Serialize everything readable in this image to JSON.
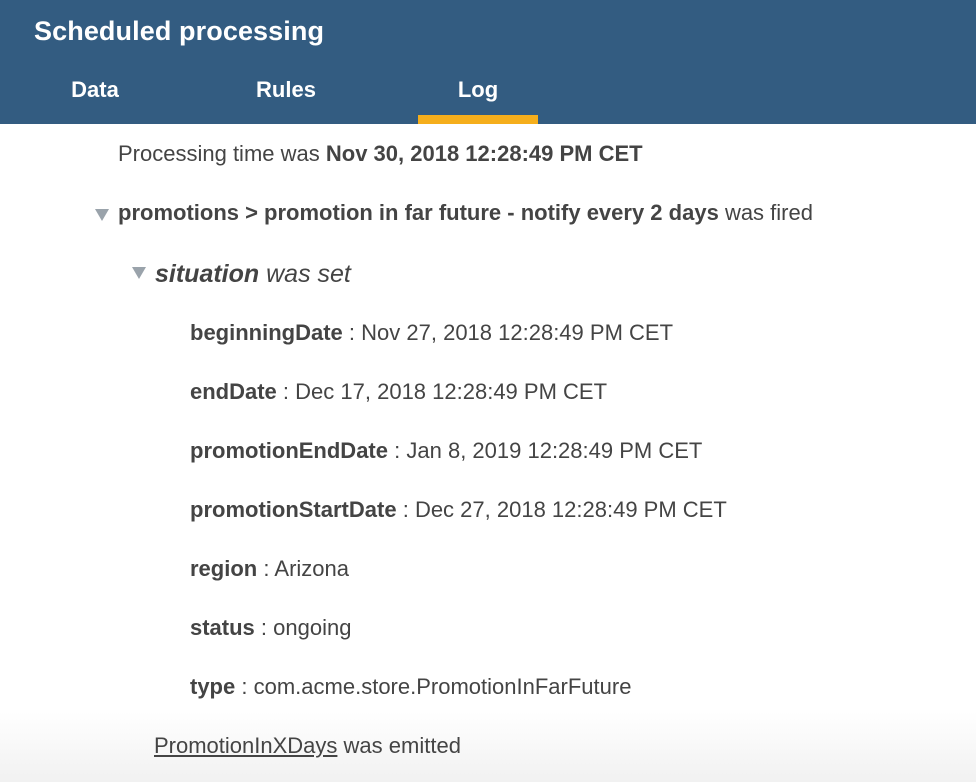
{
  "app": {
    "title": "Scheduled processing"
  },
  "tabs": [
    {
      "label": "Data",
      "selected": false
    },
    {
      "label": "Rules",
      "selected": false
    },
    {
      "label": "Log",
      "selected": true
    }
  ],
  "colors": {
    "header_bg": "#335c81",
    "active_tab_underline": "#f5ae1c",
    "toggle_icon": "#9aa3ab",
    "text": "#444444"
  },
  "log": {
    "processing_prefix": "Processing time was",
    "processing_time": "Nov 30, 2018 12:28:49 PM CET",
    "rule": {
      "name": "promotions > promotion in far future - notify every 2 days",
      "suffix": "was fired",
      "toggle_icon": "triangle-down-icon",
      "expanded": true
    },
    "situation": {
      "name": "situation",
      "suffix": "was set",
      "toggle_icon": "triangle-down-icon",
      "expanded": true,
      "separator": ":",
      "attributes": [
        {
          "key": "beginningDate",
          "value": "Nov 27, 2018 12:28:49 PM CET"
        },
        {
          "key": "endDate",
          "value": "Dec 17, 2018 12:28:49 PM CET"
        },
        {
          "key": "promotionEndDate",
          "value": "Jan 8, 2019 12:28:49 PM CET"
        },
        {
          "key": "promotionStartDate",
          "value": "Dec 27, 2018 12:28:49 PM CET"
        },
        {
          "key": "region",
          "value": "Arizona"
        },
        {
          "key": "status",
          "value": "ongoing"
        },
        {
          "key": "type",
          "value": "com.acme.store.PromotionInFarFuture"
        }
      ]
    },
    "emitted": {
      "event_name": "PromotionInXDays",
      "suffix": "was emitted"
    }
  }
}
